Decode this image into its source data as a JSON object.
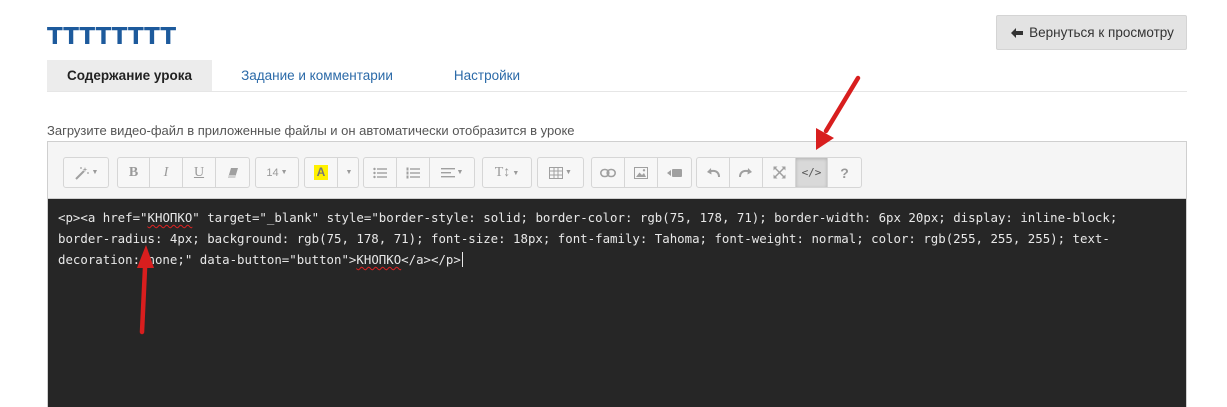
{
  "header": {
    "title": "ТТТТТТТТ",
    "back_button": "Вернуться к просмотру"
  },
  "tabs": [
    {
      "label": "Содержание урока",
      "active": true
    },
    {
      "label": "Задание и комментарии",
      "active": false
    },
    {
      "label": "Настройки",
      "active": false
    }
  ],
  "hint": "Загрузите видео-файл в приложенные файлы и он автоматически отобразится в уроке",
  "toolbar": {
    "font_size": "14",
    "bold": "B",
    "italic": "I",
    "underline": "U",
    "highlight": "A",
    "text_height": "T↕",
    "help": "?",
    "code_view_label": "</>"
  },
  "code": {
    "part1": "<p><a href=\"",
    "href_text": "КНОПКО",
    "part2": "\" target=\"_blank\" style=\"border-style: solid; border-color: rgb(75, 178, 71); border-width: 6px 20px; display: inline-block; border-radius: 4px; background: rgb(75, 178, 71); font-size: 18px; font-family: Tahoma; font-weight: normal; color: rgb(255, 255, 255); text-decoration: none;\" data-button=\"button\">",
    "link_text": "КНОПКО",
    "part3": "</a></p>"
  },
  "colors": {
    "title": "#1d5a9c",
    "tab_link": "#2b6aa8",
    "code_bg": "#262626",
    "arrow": "#d81e1e"
  }
}
